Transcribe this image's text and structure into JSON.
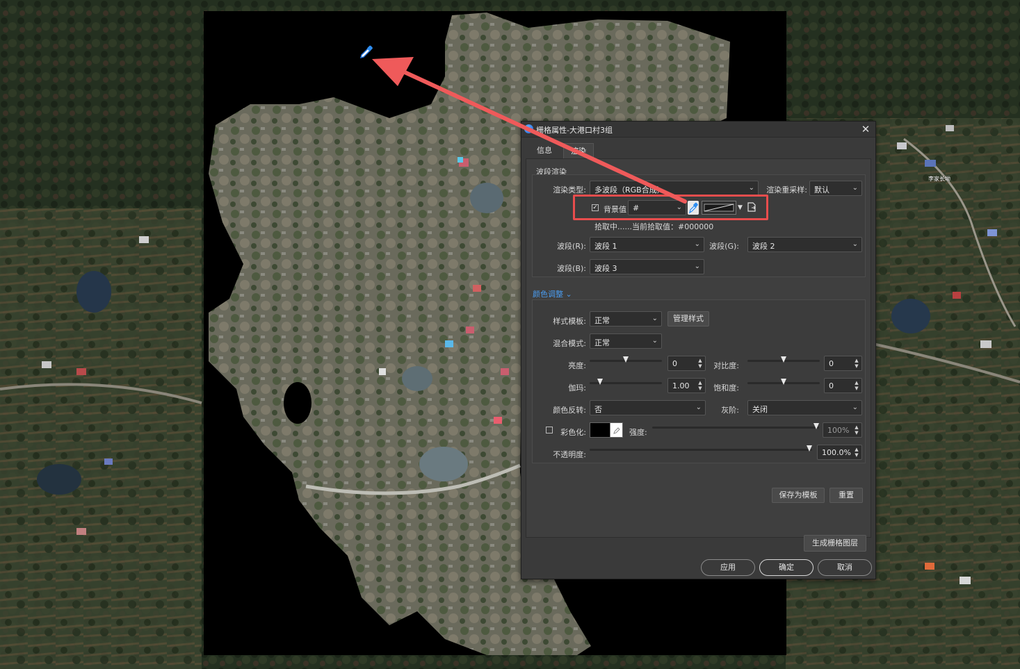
{
  "map": {
    "place_label": "李家长坳"
  },
  "dialog": {
    "title": "栅格属性-大港口村3组",
    "close_glyph": "✕",
    "tabs": [
      {
        "label": "信息"
      },
      {
        "label": "渲染"
      }
    ],
    "band_render": {
      "section_label": "波段渲染",
      "render_type_label": "渲染类型:",
      "render_type_value": "多波段（RGB合成）",
      "resample_label": "渲染重采样:",
      "resample_value": "默认",
      "background_checkbox": true,
      "background_label": "背景值",
      "background_value": "#",
      "picking_status": "拾取中......当前拾取值：#000000",
      "band_r_label": "波段(R):",
      "band_r_value": "波段 1",
      "band_g_label": "波段(G):",
      "band_g_value": "波段 2",
      "band_b_label": "波段(B):",
      "band_b_value": "波段 3"
    },
    "color_adjust": {
      "section_label": "颜色调整",
      "style_template_label": "样式模板:",
      "style_template_value": "正常",
      "manage_styles_button": "管理样式",
      "blend_mode_label": "混合模式:",
      "blend_mode_value": "正常",
      "brightness_label": "亮度:",
      "brightness_value": "0",
      "brightness_level": 0.5,
      "contrast_label": "对比度:",
      "contrast_value": "0",
      "contrast_level": 0.5,
      "gamma_label": "伽玛:",
      "gamma_value": "1.00",
      "gamma_level": 0.14,
      "saturation_label": "饱和度:",
      "saturation_value": "0",
      "saturation_level": 0.5,
      "invert_label": "颜色反转:",
      "invert_value": "否",
      "grayscale_label": "灰阶:",
      "grayscale_value": "关闭",
      "colorize_checkbox": false,
      "colorize_label": "彩色化:",
      "colorize_color": "#000000",
      "strength_label": "强度:",
      "strength_value": "100%",
      "strength_level": 1.0,
      "opacity_label": "不透明度:",
      "opacity_value": "100.0%",
      "opacity_level": 1.0,
      "save_template_button": "保存为模板",
      "reset_button": "重置"
    },
    "generate_raster_button": "生成栅格图层",
    "apply_button": "应用",
    "ok_button": "确定",
    "cancel_button": "取消"
  },
  "colors": {
    "highlight": "#e84d4d",
    "dialog_bg": "#3a3a3a",
    "raster_bg": "#000000",
    "eyedropper": "#2f8ef0"
  }
}
